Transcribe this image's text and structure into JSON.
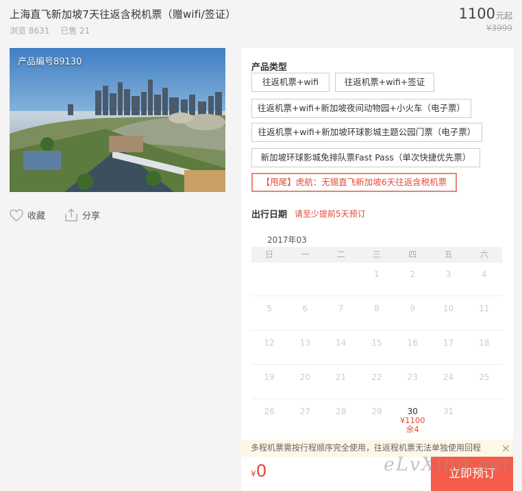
{
  "product": {
    "title": "上海直飞新加坡7天往返含税机票（赠wifi/签证）",
    "views": "浏览 8631",
    "sold": "已售 21",
    "price": "1100",
    "price_suffix": "元起",
    "original_price": "¥3999",
    "code": "产品编号89130"
  },
  "actions": {
    "favorite": "收藏",
    "share": "分享"
  },
  "product_types": {
    "label": "产品类型",
    "options": [
      "往返机票+wifi",
      "往返机票+wifi+签证",
      "往返机票+wifi+新加坡夜间动物园+小火车（电子票）",
      "往返机票+wifi+新加坡环球影城主题公园门票（电子票）",
      "新加坡环球影城免排队票Fast Pass（单次快捷优先票）",
      "【甩尾】虎航：无锡直飞新加坡6天往返含税机票"
    ]
  },
  "travel_date": {
    "label": "出行日期",
    "hint": "请至少提前5天预订",
    "month": "2017年03",
    "weekdays": [
      "日",
      "一",
      "二",
      "三",
      "四",
      "五",
      "六"
    ],
    "weeks": [
      [
        "",
        "",
        "",
        "1",
        "2",
        "3",
        "4"
      ],
      [
        "5",
        "6",
        "7",
        "8",
        "9",
        "10",
        "11"
      ],
      [
        "12",
        "13",
        "14",
        "15",
        "16",
        "17",
        "18"
      ],
      [
        "19",
        "20",
        "21",
        "22",
        "23",
        "24",
        "25"
      ],
      [
        "26",
        "27",
        "28",
        "29",
        "30",
        "31",
        ""
      ]
    ],
    "available": {
      "day": "30",
      "price": "¥1100",
      "stock": "余4"
    }
  },
  "notice": {
    "text": "多程机票需按行程顺序完全使用，往返程机票无法单独使用回程",
    "close": "×"
  },
  "total": {
    "currency": "¥",
    "amount": "0"
  },
  "book_button": "立即预订",
  "watermark": "eLvXing.net",
  "colors": {
    "accent": "#e24a36",
    "button": "#f55b4a",
    "notice_bg": "#fdf7e6"
  }
}
